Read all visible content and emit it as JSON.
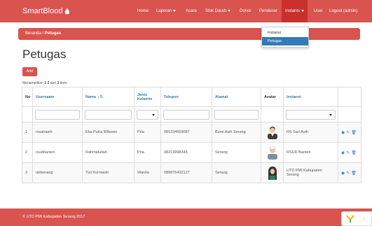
{
  "brand": {
    "name": "SmartBlood"
  },
  "nav": {
    "home": "Home",
    "laporan": "Laporan",
    "acara": "Acara",
    "stok_darah": "Stok Darah",
    "donor": "Donor",
    "pendonor": "Pendonor",
    "instansi": "Instansi",
    "user": "User",
    "logout": "Logout (admin)"
  },
  "dropdown": {
    "items": [
      "Instansi",
      "Petugas"
    ],
    "selected": "Petugas"
  },
  "breadcrumb": {
    "home": "Beranda",
    "separator": "/",
    "current": "Petugas"
  },
  "page": {
    "title": "Petugas",
    "add_label": "Add",
    "summary_prefix": "Menampilkan",
    "summary_range": "1-3",
    "summary_mid": "dari",
    "summary_total": "3",
    "summary_suffix": "item."
  },
  "table": {
    "headers": {
      "no": "No",
      "username": "Username",
      "nama": "Nama",
      "jenis_kelamin": "Jenis Kelamin",
      "telepon": "Telepon",
      "alamat": "Alamat",
      "avatar": "Avatar",
      "instansi": "Instansi"
    },
    "rows": [
      {
        "no": "1",
        "username": "rssariasih",
        "nama": "Eka Putra Wibowo",
        "jenis_kelamin": "Pria",
        "telepon": "081234659087",
        "alamat": "Bumi Asih Serang",
        "instansi": "RS Sari Asih"
      },
      {
        "no": "2",
        "username": "rsudbanten",
        "nama": "Rahmatullah",
        "jenis_kelamin": "Pria",
        "telepon": "08219998345",
        "alamat": "Serang",
        "instansi": "RSUD Banten"
      },
      {
        "no": "3",
        "username": "utdserang",
        "nama": "Yuli Kurniasih",
        "jenis_kelamin": "Wanita",
        "telepon": "089876432127",
        "alamat": "Serang",
        "instansi": "UTD PMI Kabupaten Serang"
      }
    ]
  },
  "icons": {
    "view": "eye-icon",
    "edit": "pencil-icon",
    "delete": "trash-icon",
    "sort": "sort-icon"
  },
  "colors": {
    "brand": "#d9534f",
    "link": "#337ab7",
    "selected": "#337ab7"
  },
  "footer": {
    "text": "© UTD PMI Kabupaten Serang 2017"
  }
}
